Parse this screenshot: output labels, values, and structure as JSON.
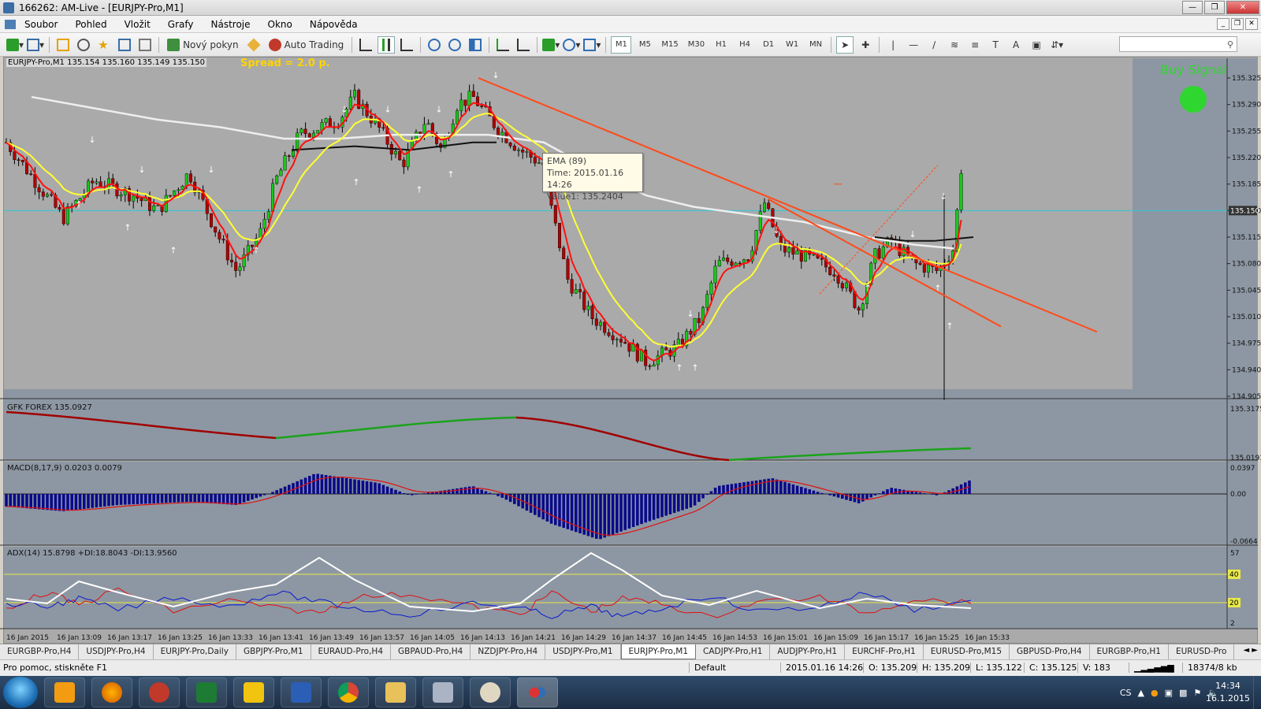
{
  "window": {
    "title": "166262: AM-Live - [EURJPY-Pro,M1]"
  },
  "menu": [
    "Soubor",
    "Pohled",
    "Vložit",
    "Grafy",
    "Nástroje",
    "Okno",
    "Nápověda"
  ],
  "toolbar": {
    "new_order": "Nový pokyn",
    "auto_trading": "Auto Trading",
    "timeframes": [
      "M1",
      "M5",
      "M15",
      "M30",
      "H1",
      "H4",
      "D1",
      "W1",
      "MN"
    ],
    "active_timeframe": "M1"
  },
  "chart": {
    "symbol_line": "EURJPY-Pro,M1  135.154 135.160 135.149 135.150",
    "spread": "Spread = 2.0 p.",
    "buy_signal": "Buy Signal",
    "buy_signal_color": "#2fd62f",
    "tooltip": {
      "line1": "EMA (89)",
      "line2": "Time: 2015.01.16 14:26",
      "line3": "Value1: 135.2404"
    },
    "price_axis": [
      "135.325",
      "135.290",
      "135.255",
      "135.220",
      "135.185",
      "135.150",
      "135.115",
      "135.080",
      "135.045",
      "135.010",
      "134.975",
      "134.940",
      "134.905"
    ],
    "current_price": "135.150",
    "time_axis": [
      "16 Jan 2015",
      "16 Jan 13:09",
      "16 Jan 13:17",
      "16 Jan 13:25",
      "16 Jan 13:33",
      "16 Jan 13:41",
      "16 Jan 13:49",
      "16 Jan 13:57",
      "16 Jan 14:05",
      "16 Jan 14:13",
      "16 Jan 14:21",
      "16 Jan 14:29",
      "16 Jan 14:37",
      "16 Jan 14:45",
      "16 Jan 14:53",
      "16 Jan 15:01",
      "16 Jan 15:09",
      "16 Jan 15:17",
      "16 Jan 15:25",
      "16 Jan 15:33"
    ],
    "colors": {
      "bull": "#18c818",
      "bear": "#b00000",
      "ema_fast": "#ff1010",
      "ema_mid": "#ffff33",
      "ema_slow": "#eeeeee",
      "ema_black": "#111111",
      "trend": "#ff4a1a",
      "bg": "#aaaaaa"
    }
  },
  "indicators": {
    "gfk": {
      "label": "GFK FOREX 135.0927",
      "axis_top": "135.3175",
      "axis_bottom": "135.0193"
    },
    "macd": {
      "label": "MACD(8,17,9) 0.0203 0.0079",
      "axis_top": "0.0397",
      "axis_mid": "0.00",
      "axis_bottom": "-0.0664"
    },
    "adx": {
      "label": "ADX(14) 15.8798 +DI:18.8043 -DI:13.9560",
      "axis_top": "57",
      "level1": "40",
      "level2": "20",
      "axis_bottom": "2"
    }
  },
  "tabs": [
    "EURGBP-Pro,H4",
    "USDJPY-Pro,H4",
    "EURJPY-Pro,Daily",
    "GBPJPY-Pro,M1",
    "EURAUD-Pro,H4",
    "GBPAUD-Pro,H4",
    "NZDJPY-Pro,H4",
    "USDJPY-Pro,M1",
    "EURJPY-Pro,M1",
    "CADJPY-Pro,H1",
    "AUDJPY-Pro,H1",
    "EURCHF-Pro,H1",
    "EURUSD-Pro,M15",
    "GBPUSD-Pro,H4",
    "EURGBP-Pro,H1",
    "EURUSD-Pro"
  ],
  "active_tab": "EURJPY-Pro,M1",
  "status": {
    "help": "Pro pomoc, stiskněte F1",
    "profile": "Default",
    "time": "2015.01.16 14:26",
    "open": "O: 135.209",
    "high": "H: 135.209",
    "low": "L: 135.122",
    "close": "C: 135.125",
    "volume": "V: 183",
    "traffic": "18374/8 kb"
  },
  "taskbar": {
    "lang": "CS",
    "time": "14:34",
    "date": "16.1.2015"
  }
}
